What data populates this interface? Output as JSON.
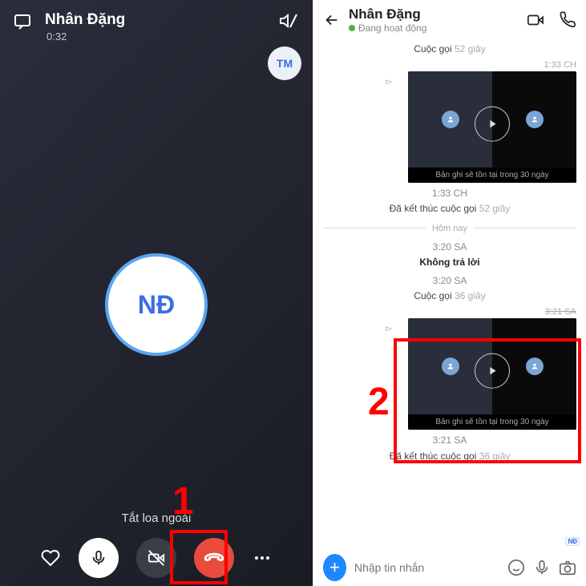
{
  "call": {
    "name": "Nhân Đặng",
    "time": "0:32",
    "remote_avatar": "TM",
    "center_avatar": "NĐ",
    "speaker_label": "Tắt loa ngoài"
  },
  "annotations": {
    "one": "1",
    "two": "2"
  },
  "chat": {
    "name": "Nhân Đặng",
    "status": "Đang hoạt động",
    "msg1": {
      "label": "Cuộc gọi",
      "dur": "52 giây"
    },
    "time1": "1:33 CH",
    "video1_caption": "Bản ghi sẽ tồn tại trong 30 ngày",
    "msg2": {
      "time": "1:33 CH",
      "label": "Đã kết thúc cuộc gọi",
      "dur": "52 giây"
    },
    "divider": "Hôm nay",
    "msg3": {
      "time": "3:20 SA",
      "label": "Không trả lời"
    },
    "msg4": {
      "time": "3:20 SA",
      "label": "Cuộc gọi",
      "dur": "36 giây"
    },
    "time2": "3:21 SA",
    "video2_caption": "Bản ghi sẽ tồn tại trong 30 ngày",
    "msg5": {
      "time": "3:21 SA",
      "label": "Đã kết thúc cuộc gọi",
      "dur": "36 giây"
    },
    "input_placeholder": "Nhập tin nhắn",
    "nd_badge": "NĐ"
  }
}
